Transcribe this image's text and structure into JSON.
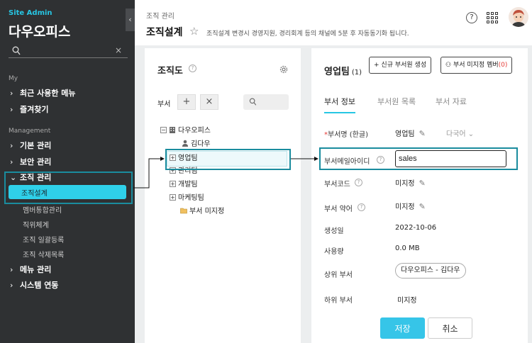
{
  "sidebar": {
    "brand_small": "Site Admin",
    "brand_title": "다우오피스",
    "search": {
      "placeholder": "",
      "clear": "×"
    },
    "sections": {
      "my": "My",
      "management": "Management"
    },
    "my_items": [
      {
        "label": "최근 사용한 메뉴"
      },
      {
        "label": "즐겨찾기"
      }
    ],
    "mgmt_items": [
      {
        "label": "기본 관리"
      },
      {
        "label": "보안 관리"
      },
      {
        "label": "조직 관리"
      }
    ],
    "sub_items": [
      {
        "label": "조직설계",
        "active": true
      },
      {
        "label": "멤버통합관리"
      },
      {
        "label": "직위체계"
      },
      {
        "label": "조직 일괄등록"
      },
      {
        "label": "조직 삭제목록"
      }
    ],
    "bottom_items": [
      {
        "label": "메뉴 관리"
      },
      {
        "label": "시스템 연동"
      }
    ]
  },
  "header": {
    "breadcrumb": "조직 관리",
    "title": "조직설계",
    "notice": "조직설계 변경시 경영지원, 경리회계 등의 채널에 5분 후 자동동기화 됩니다.",
    "help": "?"
  },
  "org_panel": {
    "title": "조직도",
    "dept_label": "부서",
    "add_symbol": "+",
    "remove_symbol": "×",
    "tree": [
      {
        "label": "다우오피스",
        "toggle": "−"
      },
      {
        "label": "김다우"
      },
      {
        "label": "영업팀",
        "toggle": "+",
        "selected": true
      },
      {
        "label": "관리팀",
        "toggle": "+"
      },
      {
        "label": "개발팀",
        "toggle": "+"
      },
      {
        "label": "마케팅팀",
        "toggle": "+"
      },
      {
        "label": "부서 미지정"
      }
    ]
  },
  "detail": {
    "dept_name": "영업팀",
    "member_count": "(1)",
    "new_member_btn": "신규 부서원 생성",
    "unassigned_btn": "부서 미지정 멤버",
    "unassigned_count": "(0)",
    "tabs": [
      "부서 정보",
      "부서원 목록",
      "부서 자료"
    ],
    "fields": {
      "name_label": "부서명 (한글)",
      "name_required": "*",
      "name_value": "영업팀",
      "lang": "다국어",
      "email_label": "부서메일아이디",
      "email_value": "sales",
      "code_label": "부서코드",
      "code_value": "미지정",
      "abbr_label": "부서 약어",
      "abbr_value": "미지정",
      "created_label": "생성일",
      "created_value": "2022-10-06",
      "usage_label": "사용량",
      "usage_value": "0.0 MB",
      "parent_label": "상위 부서",
      "parent_value": "다우오피스 - 김다우",
      "child_label": "하위 부서",
      "child_value": "미지정"
    },
    "save_label": "저장",
    "cancel_label": "취소"
  },
  "colors": {
    "accent": "#2fd0e9",
    "highlight_box": "#1a8c9e",
    "sidebar_bg": "#2f3133"
  }
}
